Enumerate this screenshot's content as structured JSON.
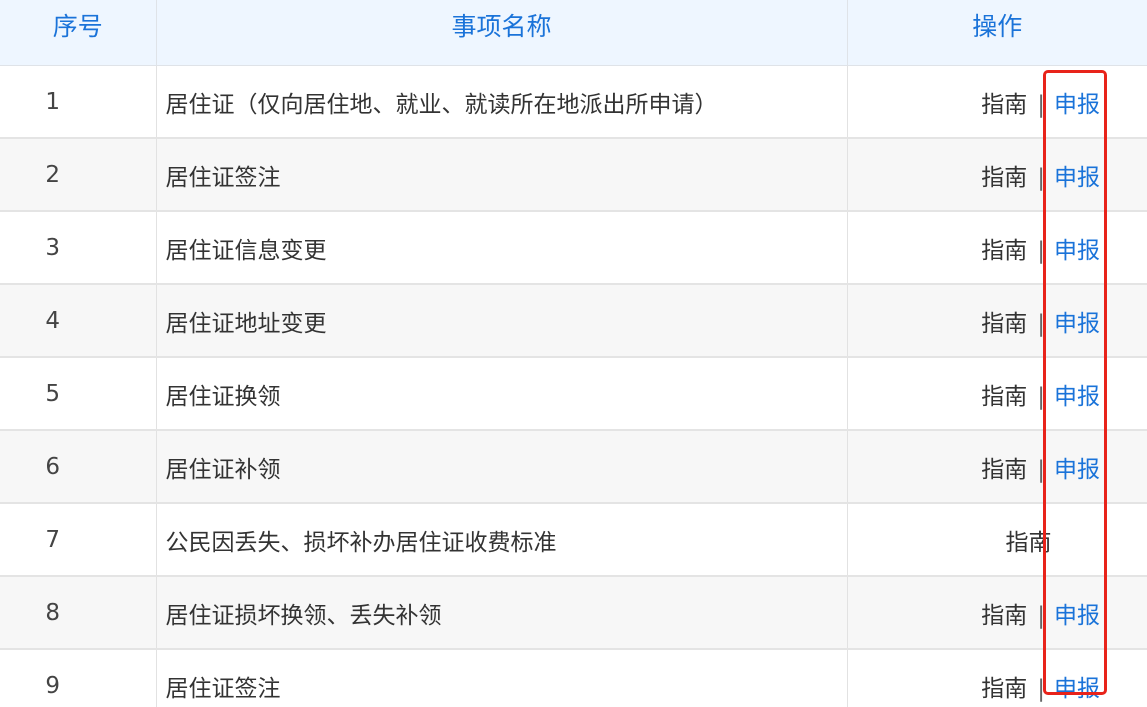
{
  "table": {
    "headers": {
      "no": "序号",
      "name": "事项名称",
      "op": "操作"
    },
    "rows": [
      {
        "no": "1",
        "name": "居住证（仅向居住地、就业、就读所在地派出所申请）",
        "guide": "指南",
        "sep": "|",
        "apply": "申报"
      },
      {
        "no": "2",
        "name": "居住证签注",
        "guide": "指南",
        "sep": "|",
        "apply": "申报"
      },
      {
        "no": "3",
        "name": "居住证信息变更",
        "guide": "指南",
        "sep": "|",
        "apply": "申报"
      },
      {
        "no": "4",
        "name": "居住证地址变更",
        "guide": "指南",
        "sep": "|",
        "apply": "申报"
      },
      {
        "no": "5",
        "name": "居住证换领",
        "guide": "指南",
        "sep": "|",
        "apply": "申报"
      },
      {
        "no": "6",
        "name": "居住证补领",
        "guide": "指南",
        "sep": "|",
        "apply": "申报"
      },
      {
        "no": "7",
        "name": "公民因丢失、损坏补办居住证收费标准",
        "guide": "指南"
      },
      {
        "no": "8",
        "name": "居住证损坏换领、丢失补领",
        "guide": "指南",
        "sep": "|",
        "apply": "申报"
      },
      {
        "no": "9",
        "name": "居住证签注",
        "guide": "指南",
        "sep": "|",
        "apply": "申报"
      }
    ]
  },
  "colors": {
    "header_bg": "#eef6ff",
    "header_text": "#1a73d9",
    "link_blue": "#1a73d9",
    "highlight_red": "#e8231a",
    "stripe_bg": "#f7f7f7"
  }
}
